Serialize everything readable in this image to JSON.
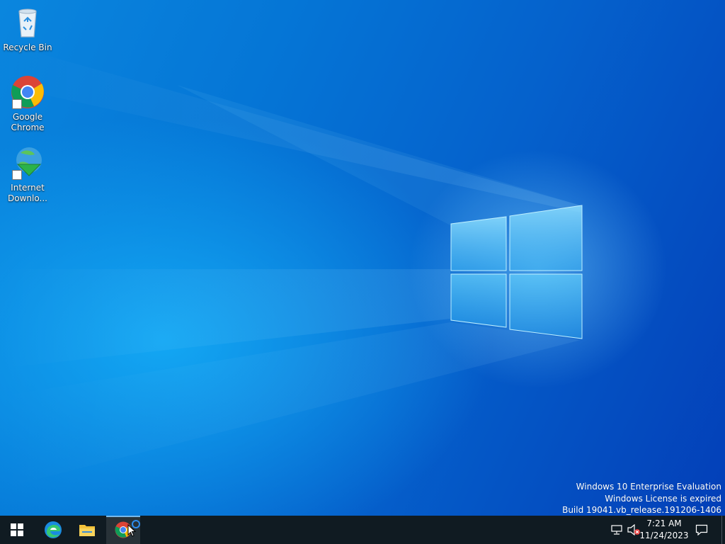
{
  "desktop": {
    "icons": [
      {
        "label": "Recycle Bin",
        "icon": "recycle-bin-icon"
      },
      {
        "label": "Google Chrome",
        "icon": "chrome-icon"
      },
      {
        "label": "Internet Downlo...",
        "icon": "internet-download-manager-icon"
      }
    ],
    "watermark": {
      "line1": "Windows 10 Enterprise Evaluation",
      "line2": "Windows License is expired",
      "line3": "Build 19041.vb_release.191206-1406"
    }
  },
  "taskbar": {
    "pinned": [
      {
        "name": "start",
        "icon": "windows-logo-icon"
      },
      {
        "name": "edge",
        "icon": "edge-icon"
      },
      {
        "name": "file-explorer",
        "icon": "folder-icon"
      },
      {
        "name": "chrome",
        "icon": "chrome-icon",
        "active": true
      }
    ],
    "tray": {
      "network_icon": "network-icon",
      "volume_icon": "volume-muted-icon",
      "notification_icon": "action-center-icon"
    },
    "clock": {
      "time": "7:21 AM",
      "date": "11/24/2023"
    }
  },
  "colors": {
    "taskbar": "#101b22",
    "wallpaper_dark": "#033fb8",
    "wallpaper_light": "#0a86de"
  }
}
